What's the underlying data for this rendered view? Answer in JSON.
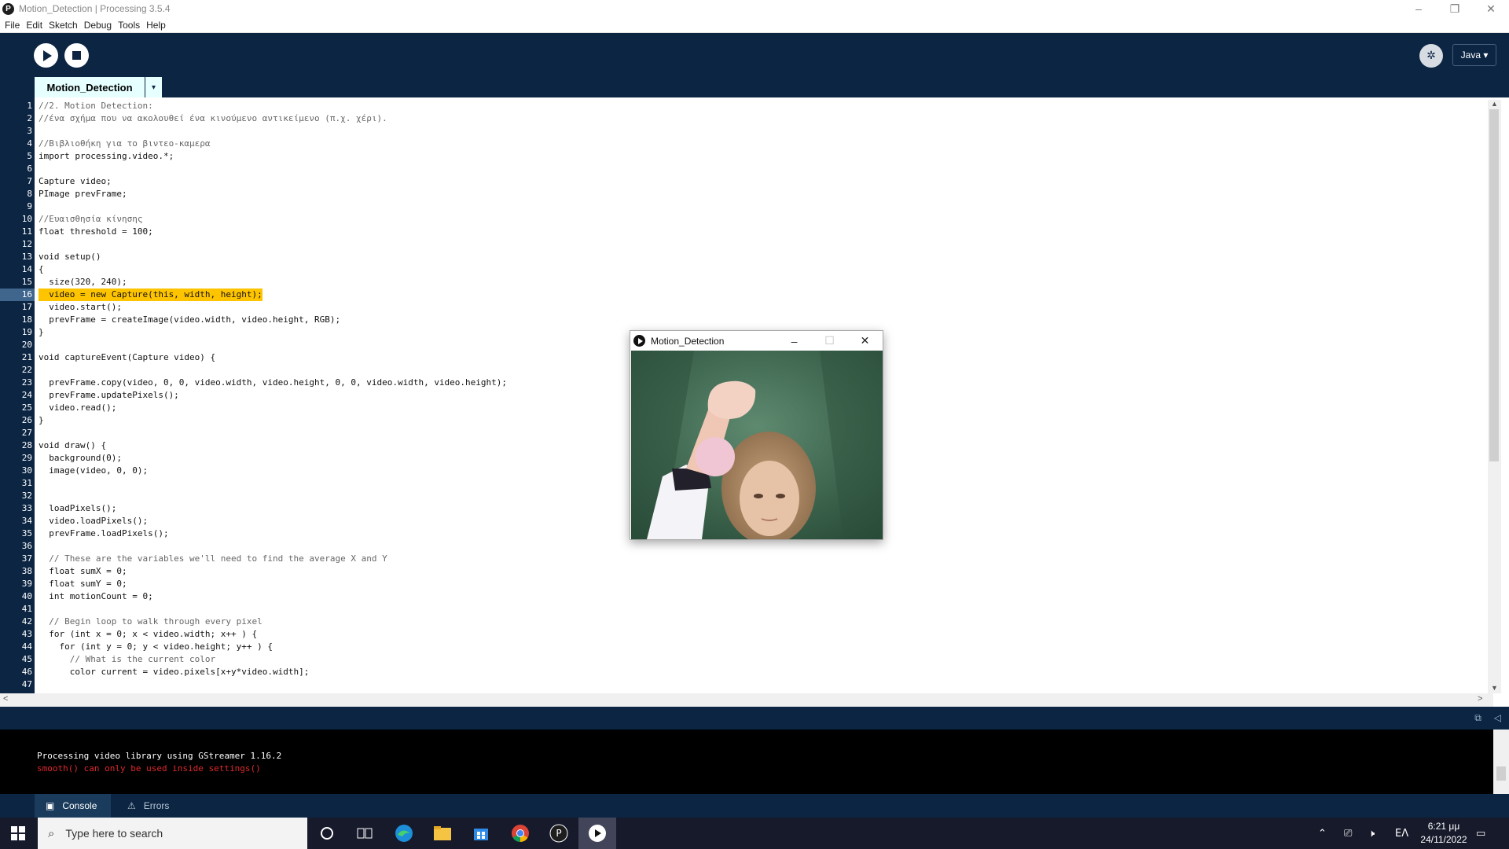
{
  "window": {
    "title": "Motion_Detection | Processing 3.5.4",
    "controls": [
      "–",
      "❐",
      "✕"
    ]
  },
  "menu": [
    "File",
    "Edit",
    "Sketch",
    "Debug",
    "Tools",
    "Help"
  ],
  "toolbar": {
    "mode_label": "Java ▾"
  },
  "tab": {
    "label": "Motion_Detection",
    "menu_glyph": "▾"
  },
  "editor": {
    "highlighted_line": 16,
    "lines": [
      {
        "n": "1",
        "text": "//2. Motion Detection:"
      },
      {
        "n": "2",
        "text": "//ένα σχήμα που να ακολουθεί ένα κινούμενο αντικείμενο (π.χ. χέρι)."
      },
      {
        "n": "3",
        "text": ""
      },
      {
        "n": "4",
        "text": "//Βιβλιοθήκη για το βιντεο-καμερα"
      },
      {
        "n": "5",
        "text": "import processing.video.*;"
      },
      {
        "n": "6",
        "text": ""
      },
      {
        "n": "7",
        "text": "Capture video;"
      },
      {
        "n": "8",
        "text": "PImage prevFrame;"
      },
      {
        "n": "9",
        "text": ""
      },
      {
        "n": "10",
        "text": "//Ευαισθησία κίνησης"
      },
      {
        "n": "11",
        "text": "float threshold = 100;"
      },
      {
        "n": "12",
        "text": ""
      },
      {
        "n": "13",
        "text": "void setup()"
      },
      {
        "n": "14",
        "text": "{"
      },
      {
        "n": "15",
        "text": "  size(320, 240);"
      },
      {
        "n": "16",
        "text": "  video = new Capture(this, width, height);"
      },
      {
        "n": "17",
        "text": "  video.start();"
      },
      {
        "n": "18",
        "text": "  prevFrame = createImage(video.width, video.height, RGB);"
      },
      {
        "n": "19",
        "text": "}"
      },
      {
        "n": "20",
        "text": ""
      },
      {
        "n": "21",
        "text": "void captureEvent(Capture video) {"
      },
      {
        "n": "22",
        "text": ""
      },
      {
        "n": "23",
        "text": "  prevFrame.copy(video, 0, 0, video.width, video.height, 0, 0, video.width, video.height);"
      },
      {
        "n": "24",
        "text": "  prevFrame.updatePixels();"
      },
      {
        "n": "25",
        "text": "  video.read();"
      },
      {
        "n": "26",
        "text": "}"
      },
      {
        "n": "27",
        "text": ""
      },
      {
        "n": "28",
        "text": "void draw() {"
      },
      {
        "n": "29",
        "text": "  background(0);"
      },
      {
        "n": "30",
        "text": "  image(video, 0, 0);"
      },
      {
        "n": "31",
        "text": ""
      },
      {
        "n": "32",
        "text": ""
      },
      {
        "n": "33",
        "text": "  loadPixels();"
      },
      {
        "n": "34",
        "text": "  video.loadPixels();"
      },
      {
        "n": "35",
        "text": "  prevFrame.loadPixels();"
      },
      {
        "n": "36",
        "text": ""
      },
      {
        "n": "37",
        "text": "  // These are the variables we'll need to find the average X and Y"
      },
      {
        "n": "38",
        "text": "  float sumX = 0;"
      },
      {
        "n": "39",
        "text": "  float sumY = 0;"
      },
      {
        "n": "40",
        "text": "  int motionCount = 0;"
      },
      {
        "n": "41",
        "text": ""
      },
      {
        "n": "42",
        "text": "  // Begin loop to walk through every pixel"
      },
      {
        "n": "43",
        "text": "  for (int x = 0; x < video.width; x++ ) {"
      },
      {
        "n": "44",
        "text": "    for (int y = 0; y < video.height; y++ ) {"
      },
      {
        "n": "45",
        "text": "      // What is the current color"
      },
      {
        "n": "46",
        "text": "      color current = video.pixels[x+y*video.width];"
      },
      {
        "n": "47",
        "text": ""
      }
    ]
  },
  "console": {
    "lines": [
      {
        "text": "Processing video library using GStreamer 1.16.2",
        "color": "#ffffff"
      },
      {
        "text": "smooth() can only be used inside settings()",
        "color": "#e0282c"
      }
    ]
  },
  "footer": {
    "console_label": "Console",
    "errors_label": "Errors"
  },
  "sketch_window": {
    "title": "Motion_Detection",
    "controls": [
      "–",
      "☐",
      "✕"
    ]
  },
  "taskbar": {
    "search_placeholder": "Type here to search",
    "language": "ΕΛ",
    "time": "6:21 μμ",
    "date": "24/11/2022",
    "apps": [
      "cortana-icon",
      "task-view-icon",
      "edge-icon",
      "file-explorer-icon",
      "store-icon",
      "chrome-icon",
      "processing-icon",
      "sketch-run-icon"
    ]
  },
  "colors": {
    "processing_navy": "#0b2543",
    "tab_bg": "#e6ffff",
    "highlight": "#ffc400",
    "error_text": "#e0282c"
  }
}
